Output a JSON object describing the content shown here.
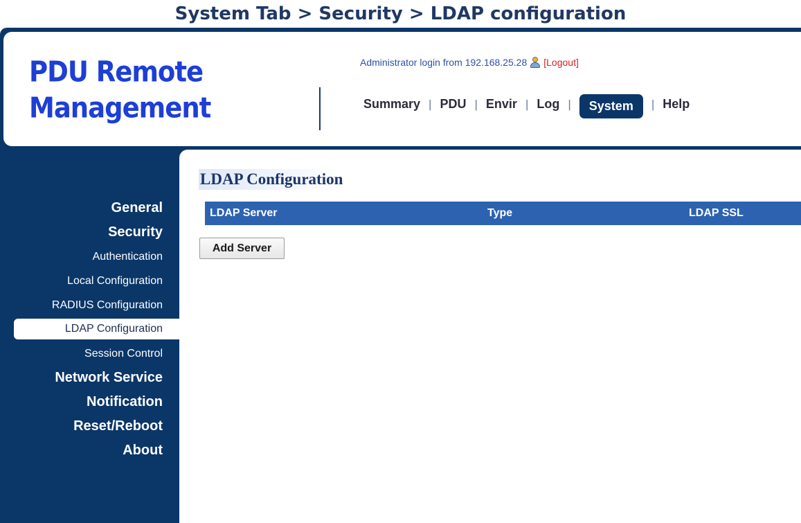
{
  "caption": "System Tab > Security > LDAP configuration",
  "header": {
    "logo_line1": "PDU Remote",
    "logo_line2": "Management",
    "login_text": "Administrator login from 192.168.25.28",
    "logout_label": "[Logout]"
  },
  "nav": {
    "items": [
      "Summary",
      "PDU",
      "Envir",
      "Log",
      "System",
      "Help"
    ],
    "separator": "|",
    "active": "System"
  },
  "sidebar": {
    "items": [
      {
        "label": "General",
        "level": "major"
      },
      {
        "label": "Security",
        "level": "major"
      },
      {
        "label": "Authentication",
        "level": "minor"
      },
      {
        "label": "Local Configuration",
        "level": "minor"
      },
      {
        "label": "RADIUS Configuration",
        "level": "minor"
      },
      {
        "label": "LDAP Configuration",
        "level": "minor",
        "selected": true
      },
      {
        "label": "Session Control",
        "level": "minor"
      },
      {
        "label": "Network Service",
        "level": "major"
      },
      {
        "label": "Notification",
        "level": "major"
      },
      {
        "label": "Reset/Reboot",
        "level": "major"
      },
      {
        "label": "About",
        "level": "major"
      }
    ]
  },
  "main": {
    "title": "LDAP Configuration",
    "table": {
      "columns": [
        "LDAP Server",
        "Type",
        "LDAP SSL"
      ],
      "rows": []
    },
    "add_button_label": "Add Server"
  },
  "colors": {
    "frame": "#0b3668",
    "logo": "#1d3fd6",
    "table_header": "#2d62b0",
    "logout": "#d61f1f"
  },
  "icons": {
    "user": "user-icon"
  }
}
